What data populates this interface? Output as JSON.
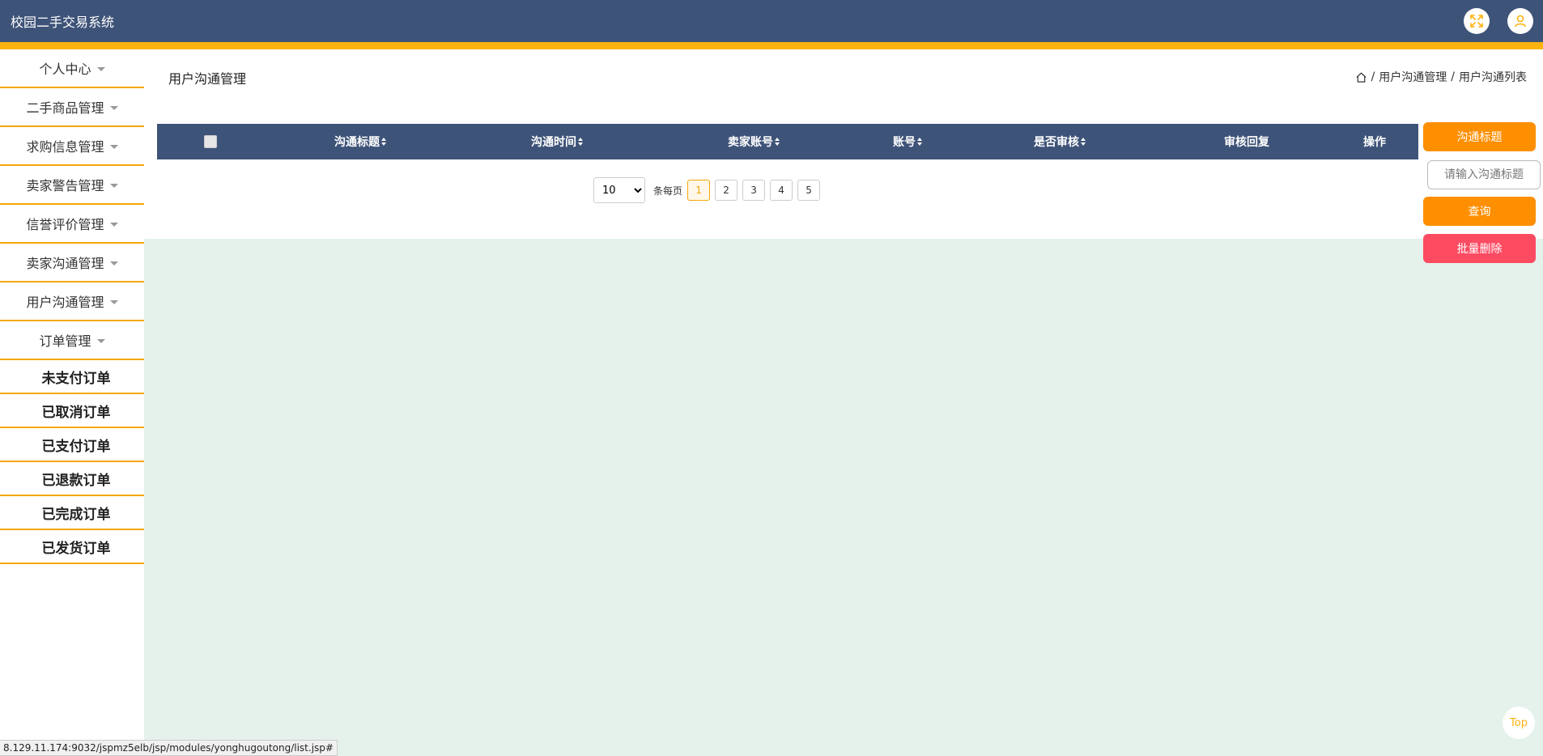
{
  "header": {
    "title": "校园二手交易系统",
    "fullscreen_icon": "expand-icon",
    "user_icon": "user-icon"
  },
  "sidebar": {
    "menus": [
      {
        "label": "个人中心"
      },
      {
        "label": "二手商品管理"
      },
      {
        "label": "求购信息管理"
      },
      {
        "label": "卖家警告管理"
      },
      {
        "label": "信誉评价管理"
      },
      {
        "label": "卖家沟通管理"
      },
      {
        "label": "用户沟通管理"
      },
      {
        "label": "订单管理"
      }
    ],
    "order_subitems": [
      {
        "label": "未支付订单"
      },
      {
        "label": "已取消订单"
      },
      {
        "label": "已支付订单"
      },
      {
        "label": "已退款订单"
      },
      {
        "label": "已完成订单"
      },
      {
        "label": "已发货订单"
      }
    ]
  },
  "main": {
    "page_title": "用户沟通管理",
    "breadcrumb": [
      "用户沟通管理",
      "用户沟通列表"
    ]
  },
  "table": {
    "columns": [
      {
        "label": "沟通标题",
        "sortable": true
      },
      {
        "label": "沟通时间",
        "sortable": true
      },
      {
        "label": "卖家账号",
        "sortable": true
      },
      {
        "label": "账号",
        "sortable": true
      },
      {
        "label": "是否审核",
        "sortable": true
      },
      {
        "label": "审核回复",
        "sortable": false
      },
      {
        "label": "操作",
        "sortable": false
      }
    ],
    "rows": []
  },
  "pagination": {
    "page_size": "10",
    "page_size_options": [
      "10"
    ],
    "per_page_label": "条每页",
    "pages": [
      "1",
      "2",
      "3",
      "4",
      "5"
    ],
    "current_page": "1"
  },
  "search": {
    "field_button": "沟通标题",
    "placeholder": "请输入沟通标题",
    "query_button": "查询",
    "batch_delete_button": "批量删除"
  },
  "top_button": "Top",
  "status_url": "8.129.11.174:9032/jspmz5elb/jsp/modules/yonghugoutong/list.jsp#",
  "colors": {
    "header_bg": "#3e5378",
    "accent": "#fdb30f",
    "orange_button": "#fd8f00",
    "delete_button": "#fd4b62",
    "content_bg": "#e5f2eb"
  }
}
